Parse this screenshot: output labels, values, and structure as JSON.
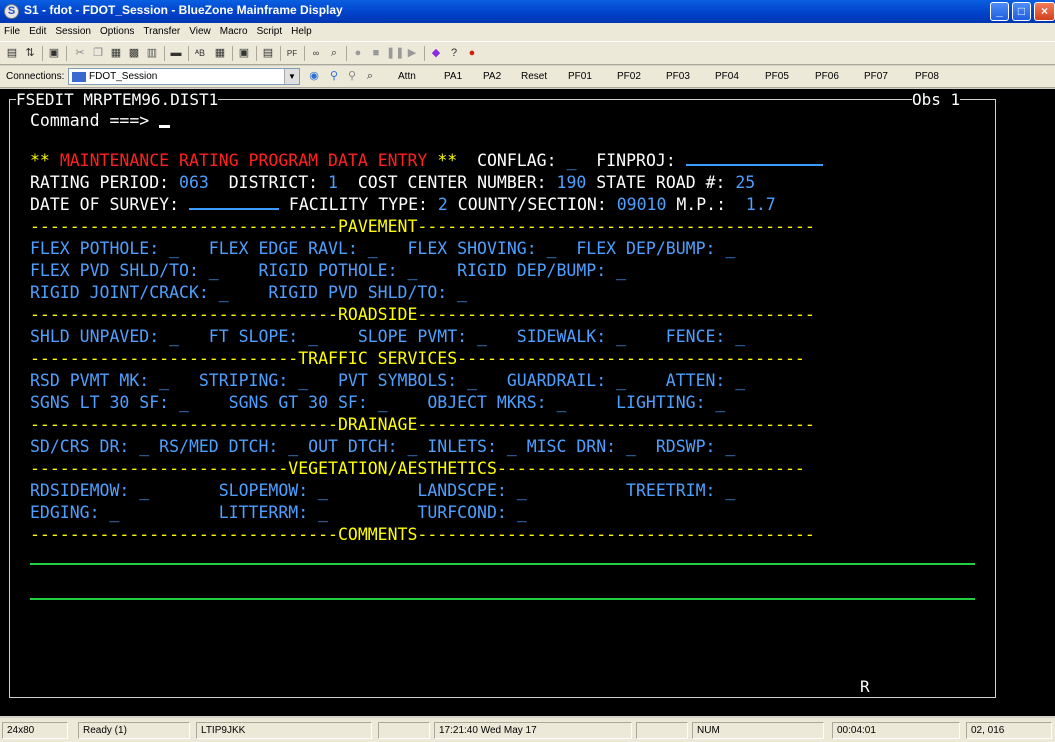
{
  "window": {
    "title": "S1 - fdot - FDOT_Session - BlueZone Mainframe Display",
    "app_icon": "bluezone-s-icon",
    "min_label": "_",
    "max_label": "□",
    "close_label": "×"
  },
  "menu": [
    "File",
    "Edit",
    "Session",
    "Options",
    "Transfer",
    "View",
    "Macro",
    "Script",
    "Help"
  ],
  "toolbar": {
    "icons": [
      "send-icon",
      "receive-icon",
      "host-icon",
      "cut-icon",
      "copy-icon",
      "paste-icon",
      "save-icon",
      "print-icon",
      "copy-screen-icon",
      "display-icon",
      "font-icon",
      "grid-icon",
      "host-icon-2",
      "doc-icon",
      "hotspot-icon",
      "find-icon",
      "record-icon",
      "stop-icon",
      "pause-icon",
      "play-icon",
      "macro-icon",
      "help-icon",
      "apple-icon"
    ]
  },
  "connections": {
    "label": "Connections:",
    "session": "FDOT_Session",
    "keys": [
      "Attn",
      "PA1",
      "PA2",
      "Reset",
      "PF01",
      "PF02",
      "PF03",
      "PF04",
      "PF05",
      "PF06",
      "PF07",
      "PF08"
    ]
  },
  "terminal": {
    "header_left": "FSEDIT MRPTEM96.DIST1",
    "header_right": "Obs 1",
    "command_label": "Command ===>",
    "footer_right": "R",
    "title_stars_left": "**",
    "title_text": "MAINTENANCE RATING PROGRAM DATA ENTRY",
    "title_stars_right": "**",
    "conflag_label": "CONFLAG:",
    "conflag_value": "_",
    "finproj_label": "FINPROJ:",
    "rating_period_label": "RATING PERIOD:",
    "rating_period_value": "063",
    "district_label": "DISTRICT:",
    "district_value": "1",
    "cost_center_label": "COST CENTER NUMBER:",
    "cost_center_value": "190",
    "state_road_label": "STATE ROAD #:",
    "state_road_value": "25",
    "date_survey_label": "DATE OF SURVEY:",
    "facility_label": "FACILITY TYPE:",
    "facility_value": "2",
    "county_label": "COUNTY/SECTION:",
    "county_value": "09010",
    "mp_label": "M.P.:",
    "mp_value": "1.7",
    "sep_pavement": "-------------------------------PAVEMENT----------------------------------------",
    "pavement_l1": "FLEX POTHOLE: _   FLEX EDGE RAVL: _   FLEX SHOVING: _  FLEX DEP/BUMP: _",
    "pavement_l2": "FLEX PVD SHLD/TO: _    RIGID POTHOLE: _    RIGID DEP/BUMP: _",
    "pavement_l3": "RIGID JOINT/CRACK: _    RIGID PVD SHLD/TO: _",
    "sep_roadside": "-------------------------------ROADSIDE----------------------------------------",
    "roadside_l1": "SHLD UNPAVED: _   FT SLOPE: _    SLOPE PVMT: _   SIDEWALK: _    FENCE: _",
    "sep_traffic": "---------------------------TRAFFIC SERVICES-----------------------------------",
    "traffic_l1": "RSD PVMT MK: _   STRIPING: _   PVT SYMBOLS: _   GUARDRAIL: _    ATTEN: _",
    "traffic_l2": "SGNS LT 30 SF: _    SGNS GT 30 SF: _    OBJECT MKRS: _     LIGHTING: _",
    "sep_drainage": "-------------------------------DRAINAGE----------------------------------------",
    "drainage_l1": "SD/CRS DR: _ RS/MED DTCH: _ OUT DTCH: _ INLETS: _ MISC DRN: _  RDSWP: _",
    "sep_vegetation": "--------------------------VEGETATION/AESTHETICS-------------------------------",
    "veg_l1": "RDSIDEMOW: _       SLOPEMOW: _         LANDSCPE: _          TREETRIM: _",
    "veg_l2": "EDGING: _          LITTERRM: _         TURFCOND: _",
    "sep_comments": "-------------------------------COMMENTS----------------------------------------"
  },
  "status": {
    "size": "24x80",
    "ready": "Ready (1)",
    "lu": "LTIP9JKK",
    "clock": "17:21:40 Wed May 17",
    "num": "NUM",
    "elapsed": "00:04:01",
    "cursor_pos": "02, 016"
  }
}
